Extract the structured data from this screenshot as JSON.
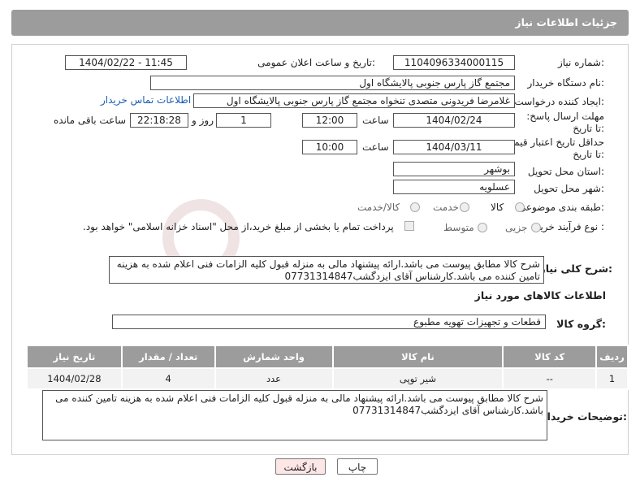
{
  "header": {
    "title": "جزئیات اطلاعات نیاز"
  },
  "form": {
    "need_number_label": "شماره نیاز:",
    "need_number": "1104096334000115",
    "announce_label": "تاریخ و ساعت اعلان عمومی:",
    "announce_value": "1404/02/22 - 11:45",
    "buyer_label": "نام دستگاه خریدار:",
    "buyer_value": "مجتمع گاز پارس جنوبی  پالایشگاه اول",
    "creator_label": "ایجاد کننده درخواست:",
    "creator_value": "غلامرضا فریدونی متصدی تنخواه مجتمع گاز پارس جنوبی  پالایشگاه اول",
    "contact_link": "اطلاعات تماس خریدار",
    "deadline_label": "مهلت ارسال پاسخ: تا تاریخ:",
    "deadline_date": "1404/02/24",
    "time_label": "ساعت",
    "deadline_time": "12:00",
    "days_value": "1",
    "days_label": "روز و",
    "remaining_time": "22:18:28",
    "remaining_label": "ساعت باقی مانده",
    "validity_label": "حداقل تاریخ اعتبار قیمت: تا تاریخ:",
    "validity_date": "1404/03/11",
    "validity_time": "10:00",
    "province_label": "استان محل تحویل:",
    "province_value": "بوشهر",
    "city_label": "شهر محل تحویل:",
    "city_value": "عسلویه",
    "category_label": "طبقه بندی موضوعی:",
    "category_options": [
      "کالا",
      "خدمت",
      "کالا/خدمت"
    ],
    "process_label": "نوع فرآیند خرید :",
    "process_options": [
      "جزیی",
      "متوسط"
    ],
    "payment_note": "پرداخت تمام یا بخشی از مبلغ خرید،از محل \"اسناد خزانه اسلامی\" خواهد بود."
  },
  "description": {
    "label": "شرح کلی نیاز:",
    "text": "شرح کالا مطابق پیوست می باشد.ارائه پیشنهاد مالی به منزله قبول کلیه الزامات فنی اعلام شده به هزینه تامین کننده می باشد.کارشناس آقای ایزدگشب07731314847"
  },
  "goods_section": {
    "title": "اطلاعات کالاهای مورد نیاز",
    "group_label": "گروه کالا:",
    "group_value": "قطعات و تجهیزات تهویه مطبوع"
  },
  "goods_table": {
    "headers": [
      "ردیف",
      "کد کالا",
      "نام کالا",
      "واحد شمارش",
      "تعداد / مقدار",
      "تاریخ نیاز"
    ],
    "rows": [
      [
        "1",
        "--",
        "شیر توپی",
        "عدد",
        "4",
        "1404/02/28"
      ]
    ]
  },
  "buyer_notes": {
    "label": "توضیحات خریدار:",
    "text": "شرح کالا مطابق پیوست می باشد.ارائه پیشنهاد مالی به منزله قبول کلیه الزامات فنی اعلام شده به هزینه تامین کننده می باشد.کارشناس آقای ایزدگشب07731314847"
  },
  "buttons": {
    "print": "چاپ",
    "back": "بازگشت"
  },
  "colors": {
    "header_bg": "#9c9c9c",
    "link": "#1a5fb4",
    "back_button_bg": "#fde6e6"
  }
}
